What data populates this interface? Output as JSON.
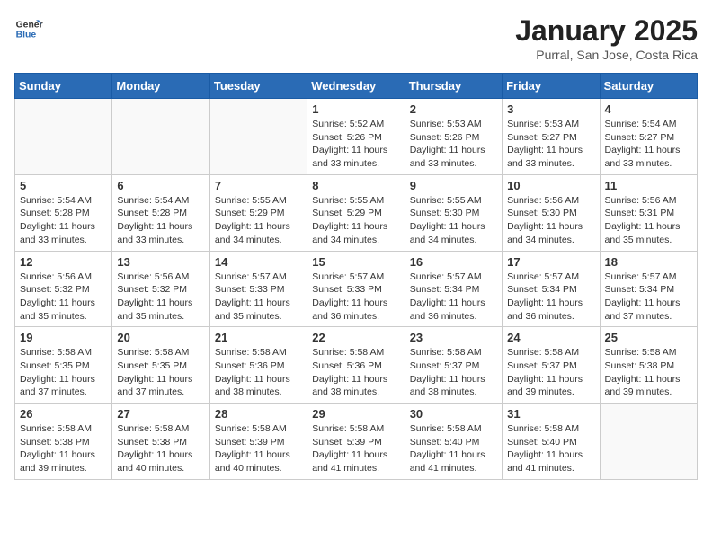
{
  "logo": {
    "line1": "General",
    "line2": "Blue"
  },
  "title": "January 2025",
  "subtitle": "Purral, San Jose, Costa Rica",
  "weekdays": [
    "Sunday",
    "Monday",
    "Tuesday",
    "Wednesday",
    "Thursday",
    "Friday",
    "Saturday"
  ],
  "weeks": [
    [
      {
        "day": "",
        "info": ""
      },
      {
        "day": "",
        "info": ""
      },
      {
        "day": "",
        "info": ""
      },
      {
        "day": "1",
        "info": "Sunrise: 5:52 AM\nSunset: 5:26 PM\nDaylight: 11 hours\nand 33 minutes."
      },
      {
        "day": "2",
        "info": "Sunrise: 5:53 AM\nSunset: 5:26 PM\nDaylight: 11 hours\nand 33 minutes."
      },
      {
        "day": "3",
        "info": "Sunrise: 5:53 AM\nSunset: 5:27 PM\nDaylight: 11 hours\nand 33 minutes."
      },
      {
        "day": "4",
        "info": "Sunrise: 5:54 AM\nSunset: 5:27 PM\nDaylight: 11 hours\nand 33 minutes."
      }
    ],
    [
      {
        "day": "5",
        "info": "Sunrise: 5:54 AM\nSunset: 5:28 PM\nDaylight: 11 hours\nand 33 minutes."
      },
      {
        "day": "6",
        "info": "Sunrise: 5:54 AM\nSunset: 5:28 PM\nDaylight: 11 hours\nand 33 minutes."
      },
      {
        "day": "7",
        "info": "Sunrise: 5:55 AM\nSunset: 5:29 PM\nDaylight: 11 hours\nand 34 minutes."
      },
      {
        "day": "8",
        "info": "Sunrise: 5:55 AM\nSunset: 5:29 PM\nDaylight: 11 hours\nand 34 minutes."
      },
      {
        "day": "9",
        "info": "Sunrise: 5:55 AM\nSunset: 5:30 PM\nDaylight: 11 hours\nand 34 minutes."
      },
      {
        "day": "10",
        "info": "Sunrise: 5:56 AM\nSunset: 5:30 PM\nDaylight: 11 hours\nand 34 minutes."
      },
      {
        "day": "11",
        "info": "Sunrise: 5:56 AM\nSunset: 5:31 PM\nDaylight: 11 hours\nand 35 minutes."
      }
    ],
    [
      {
        "day": "12",
        "info": "Sunrise: 5:56 AM\nSunset: 5:32 PM\nDaylight: 11 hours\nand 35 minutes."
      },
      {
        "day": "13",
        "info": "Sunrise: 5:56 AM\nSunset: 5:32 PM\nDaylight: 11 hours\nand 35 minutes."
      },
      {
        "day": "14",
        "info": "Sunrise: 5:57 AM\nSunset: 5:33 PM\nDaylight: 11 hours\nand 35 minutes."
      },
      {
        "day": "15",
        "info": "Sunrise: 5:57 AM\nSunset: 5:33 PM\nDaylight: 11 hours\nand 36 minutes."
      },
      {
        "day": "16",
        "info": "Sunrise: 5:57 AM\nSunset: 5:34 PM\nDaylight: 11 hours\nand 36 minutes."
      },
      {
        "day": "17",
        "info": "Sunrise: 5:57 AM\nSunset: 5:34 PM\nDaylight: 11 hours\nand 36 minutes."
      },
      {
        "day": "18",
        "info": "Sunrise: 5:57 AM\nSunset: 5:34 PM\nDaylight: 11 hours\nand 37 minutes."
      }
    ],
    [
      {
        "day": "19",
        "info": "Sunrise: 5:58 AM\nSunset: 5:35 PM\nDaylight: 11 hours\nand 37 minutes."
      },
      {
        "day": "20",
        "info": "Sunrise: 5:58 AM\nSunset: 5:35 PM\nDaylight: 11 hours\nand 37 minutes."
      },
      {
        "day": "21",
        "info": "Sunrise: 5:58 AM\nSunset: 5:36 PM\nDaylight: 11 hours\nand 38 minutes."
      },
      {
        "day": "22",
        "info": "Sunrise: 5:58 AM\nSunset: 5:36 PM\nDaylight: 11 hours\nand 38 minutes."
      },
      {
        "day": "23",
        "info": "Sunrise: 5:58 AM\nSunset: 5:37 PM\nDaylight: 11 hours\nand 38 minutes."
      },
      {
        "day": "24",
        "info": "Sunrise: 5:58 AM\nSunset: 5:37 PM\nDaylight: 11 hours\nand 39 minutes."
      },
      {
        "day": "25",
        "info": "Sunrise: 5:58 AM\nSunset: 5:38 PM\nDaylight: 11 hours\nand 39 minutes."
      }
    ],
    [
      {
        "day": "26",
        "info": "Sunrise: 5:58 AM\nSunset: 5:38 PM\nDaylight: 11 hours\nand 39 minutes."
      },
      {
        "day": "27",
        "info": "Sunrise: 5:58 AM\nSunset: 5:38 PM\nDaylight: 11 hours\nand 40 minutes."
      },
      {
        "day": "28",
        "info": "Sunrise: 5:58 AM\nSunset: 5:39 PM\nDaylight: 11 hours\nand 40 minutes."
      },
      {
        "day": "29",
        "info": "Sunrise: 5:58 AM\nSunset: 5:39 PM\nDaylight: 11 hours\nand 41 minutes."
      },
      {
        "day": "30",
        "info": "Sunrise: 5:58 AM\nSunset: 5:40 PM\nDaylight: 11 hours\nand 41 minutes."
      },
      {
        "day": "31",
        "info": "Sunrise: 5:58 AM\nSunset: 5:40 PM\nDaylight: 11 hours\nand 41 minutes."
      },
      {
        "day": "",
        "info": ""
      }
    ]
  ]
}
